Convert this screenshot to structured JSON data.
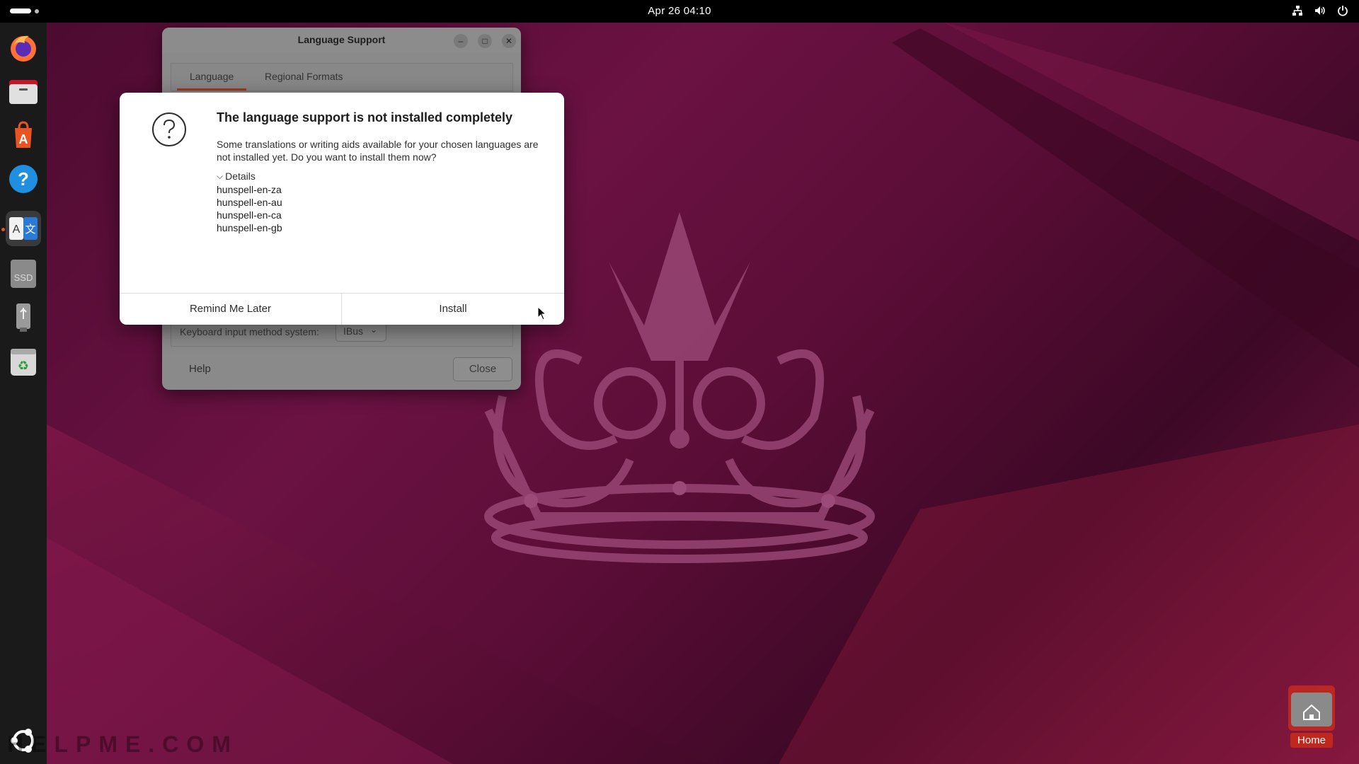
{
  "topbar": {
    "clock": "Apr 26  04:10",
    "tray_icons": [
      "network-icon",
      "volume-icon",
      "power-icon"
    ]
  },
  "dock": {
    "items": [
      {
        "name": "firefox",
        "icon": "firefox-icon"
      },
      {
        "name": "files",
        "icon": "files-icon"
      },
      {
        "name": "app-center",
        "icon": "app-center-icon"
      },
      {
        "name": "help",
        "icon": "help-icon"
      },
      {
        "name": "language-support",
        "icon": "language-support-icon",
        "active": true
      },
      {
        "name": "ssd-drive",
        "icon": "ssd-drive-icon",
        "label": "SSD"
      },
      {
        "name": "usb-drive",
        "icon": "usb-drive-icon"
      },
      {
        "name": "trash",
        "icon": "trash-icon"
      }
    ],
    "show_apps_icon": "ubuntu-logo-icon"
  },
  "language_window": {
    "title": "Language Support",
    "tabs": [
      "Language",
      "Regional Formats"
    ],
    "active_tab": "Language",
    "keyboard_label": "Keyboard input method system:",
    "keyboard_value": "IBus",
    "help_label": "Help",
    "close_label": "Close"
  },
  "dialog": {
    "title": "The language support is not installed completely",
    "message": "Some translations or writing aids available for your chosen languages are not installed yet. Do you want to install them now?",
    "details_label": "Details",
    "details": [
      "hunspell-en-za",
      "hunspell-en-au",
      "hunspell-en-ca",
      "hunspell-en-gb"
    ],
    "remind_label": "Remind Me Later",
    "install_label": "Install"
  },
  "desktop": {
    "watermark": "HELPME.COM",
    "home_label": "Home"
  },
  "colors": {
    "accent": "#e95420",
    "tab_underline": "#a2381a",
    "home_label_bg": "#c0281d"
  }
}
